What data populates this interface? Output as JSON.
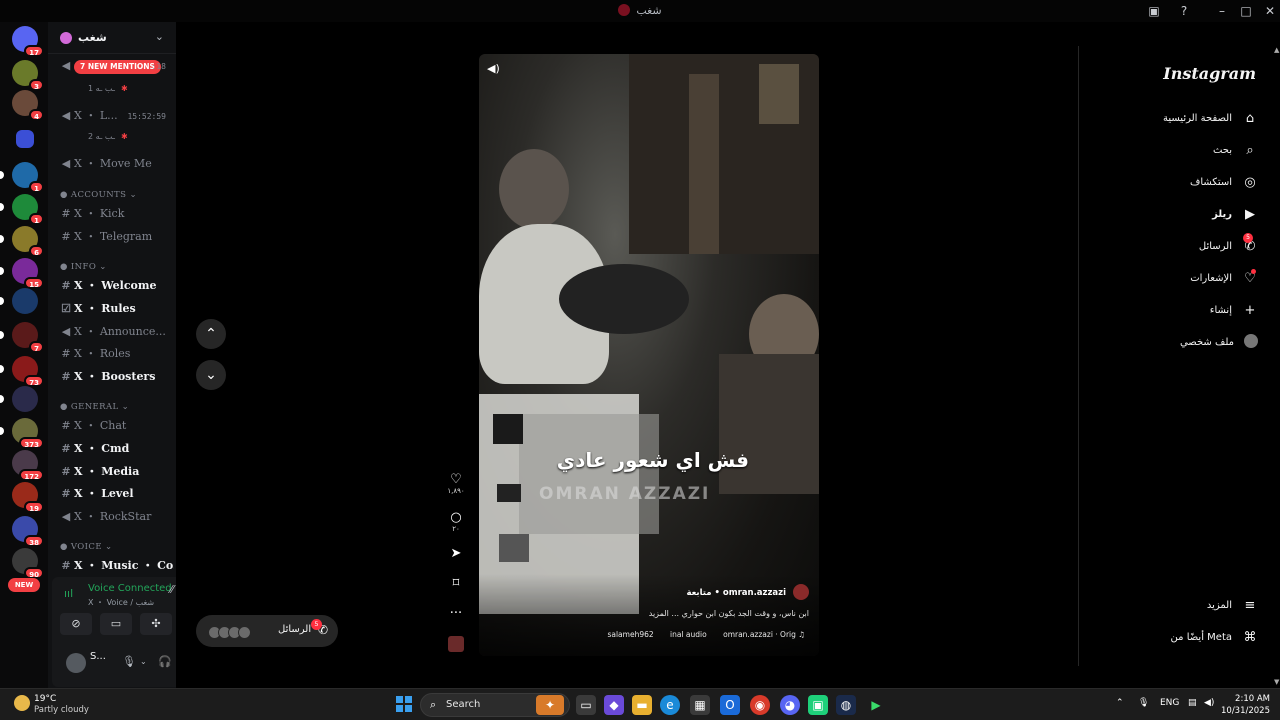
{
  "window": {
    "title": "شغب"
  },
  "servers": {
    "items": [
      {
        "name": "discord-home",
        "badge": "17",
        "color": "#5865f2"
      },
      {
        "name": "server-2",
        "badge": "3",
        "color": "#6a7a2a"
      },
      {
        "name": "server-3",
        "badge": "4",
        "color": "#6a4a3a"
      },
      {
        "name": "folder",
        "badge": "",
        "color": "#3b4fd6"
      },
      {
        "name": "server-5",
        "badge": "1",
        "color": "#1f6aa8"
      },
      {
        "name": "server-6",
        "badge": "1",
        "color": "#1e8a3a"
      },
      {
        "name": "server-7",
        "badge": "6",
        "color": "#8a7a2a"
      },
      {
        "name": "server-8",
        "badge": "15",
        "color": "#7a2a9a"
      },
      {
        "name": "server-9",
        "badge": "",
        "color": "#1a3a6a"
      },
      {
        "name": "server-10",
        "badge": "7",
        "color": "#5a1a1a"
      },
      {
        "name": "server-11",
        "badge": "73",
        "color": "#8a1a1a"
      },
      {
        "name": "server-12",
        "badge": "",
        "color": "#2a2a4a"
      },
      {
        "name": "server-13",
        "badge": "373",
        "color": "#6a6a3a"
      },
      {
        "name": "server-14",
        "badge": "172",
        "color": "#4a3a4a"
      },
      {
        "name": "server-15",
        "badge": "19",
        "color": "#9a2a1a"
      },
      {
        "name": "server-16",
        "badge": "38",
        "color": "#3a4aaa"
      },
      {
        "name": "server-17",
        "badge": "90",
        "color": "#3a3a3a"
      }
    ],
    "new_label": "NEW"
  },
  "channels": {
    "guild_name": "شغب",
    "new_mentions": "7 NEW MENTIONS",
    "voice_rows": [
      {
        "label": "X ・ L...",
        "time": "15:52:59",
        "sub": "ـب ـه 1"
      },
      {
        "label": "X ・ L...",
        "time": "15:52:59",
        "sub": "ـب ـه 2"
      }
    ],
    "mention_time": ":18",
    "move_me": "X ・ Move Me",
    "categories": {
      "accounts": "ACCOUNTS",
      "info": "INFO",
      "general": "GENERAL",
      "voice": "VOICE"
    },
    "accounts": [
      "X ・ Kick",
      "X ・ Telegram"
    ],
    "info": [
      "X ・ Welcome",
      "X ・ Rules",
      "X ・ Announce...",
      "X ・ Roles",
      "X ・ Boosters"
    ],
    "general": [
      "X ・ Chat",
      "X ・ Cmd",
      "X ・ Media",
      "X ・ Level",
      "X ・ RockStar"
    ],
    "voice": [
      "X ・ Music ・ Co..."
    ]
  },
  "voice_panel": {
    "title": "Voice Connected",
    "subtitle": "X ・ Voice / شغب"
  },
  "user": {
    "name": "S..."
  },
  "reel": {
    "overlay_text": "فش اي شعور عادي",
    "watermark": "OMRAN AZZAZI",
    "author": "omran.azzazi",
    "follow": "متابعة",
    "caption": "ابن ناس، و وقت الجد بكون ابن حواري ... المزيد",
    "audio": [
      "salameh962",
      "inal audio",
      "omran.azzazi · Orig"
    ],
    "likes": "١,٨٩٠",
    "comments": "٢٠"
  },
  "messages_pill": {
    "label": "الرسائل",
    "badge": "5"
  },
  "instagram": {
    "logo": "Instagram",
    "nav": [
      {
        "label": "الصفحة الرئيسية",
        "icon": "home-icon",
        "glyph": "⌂"
      },
      {
        "label": "بحث",
        "icon": "search-icon",
        "glyph": "⌕"
      },
      {
        "label": "استكشاف",
        "icon": "compass-icon",
        "glyph": "◎"
      },
      {
        "label": "ريلز",
        "icon": "reels-icon",
        "glyph": "▶"
      },
      {
        "label": "الرسائل",
        "icon": "messenger-icon",
        "glyph": "✆",
        "badge": "5"
      },
      {
        "label": "الإشعارات",
        "icon": "heart-icon",
        "glyph": "♡"
      },
      {
        "label": "إنشاء",
        "icon": "plus-icon",
        "glyph": "+"
      },
      {
        "label": "ملف شخصي",
        "icon": "profile-avatar",
        "glyph": ""
      }
    ],
    "more": "المزيد",
    "meta": "أيضًا من Meta"
  },
  "taskbar": {
    "temp": "19°C",
    "weather": "Partly cloudy",
    "search": "Search",
    "lang": "ENG",
    "time": "2:10 AM",
    "date": "10/31/2025"
  }
}
